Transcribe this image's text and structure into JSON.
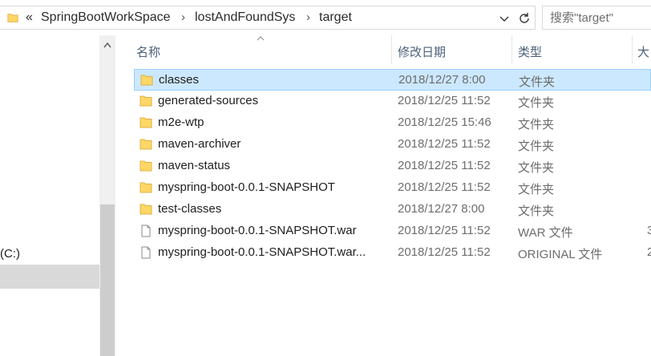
{
  "address_bar": {
    "overflow": "«",
    "breadcrumbs": [
      "SpringBootWorkSpace",
      "lostAndFoundSys",
      "target"
    ],
    "separator": "›",
    "icons": [
      "folder-icon",
      "chevron-down-icon",
      "refresh-icon"
    ]
  },
  "search": {
    "placeholder": "搜索\"target\""
  },
  "columns": {
    "name": "名称",
    "date": "修改日期",
    "type": "类型",
    "size": "大"
  },
  "nav_pane": {
    "drive_label": "(C:)"
  },
  "files": [
    {
      "name": "classes",
      "date": "2018/12/27 8:00",
      "type": "文件夹",
      "size": "",
      "icon": "folder-icon",
      "selected": true
    },
    {
      "name": "generated-sources",
      "date": "2018/12/25 11:52",
      "type": "文件夹",
      "size": "",
      "icon": "folder-icon"
    },
    {
      "name": "m2e-wtp",
      "date": "2018/12/25 15:46",
      "type": "文件夹",
      "size": "",
      "icon": "folder-icon"
    },
    {
      "name": "maven-archiver",
      "date": "2018/12/25 11:52",
      "type": "文件夹",
      "size": "",
      "icon": "folder-icon"
    },
    {
      "name": "maven-status",
      "date": "2018/12/25 11:52",
      "type": "文件夹",
      "size": "",
      "icon": "folder-icon"
    },
    {
      "name": "myspring-boot-0.0.1-SNAPSHOT",
      "date": "2018/12/25 11:52",
      "type": "文件夹",
      "size": "",
      "icon": "folder-icon"
    },
    {
      "name": "test-classes",
      "date": "2018/12/27 8:00",
      "type": "文件夹",
      "size": "",
      "icon": "folder-icon"
    },
    {
      "name": "myspring-boot-0.0.1-SNAPSHOT.war",
      "date": "2018/12/25 11:52",
      "type": "WAR 文件",
      "size": "3",
      "icon": "file-icon"
    },
    {
      "name": "myspring-boot-0.0.1-SNAPSHOT.war...",
      "date": "2018/12/25 11:52",
      "type": "ORIGINAL 文件",
      "size": "2",
      "icon": "file-icon"
    }
  ],
  "colors": {
    "selection_bg": "#cce8ff",
    "selection_border": "#99d1ff",
    "folder": "#ffd766",
    "header_text": "#4c607a"
  }
}
